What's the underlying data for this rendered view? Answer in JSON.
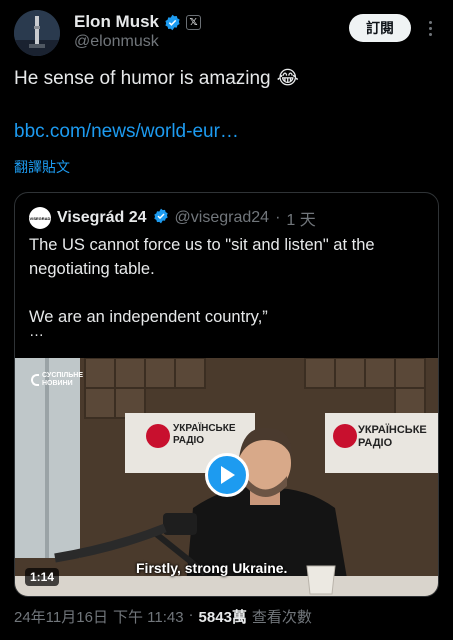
{
  "author": {
    "name": "Elon Musk",
    "handle": "@elonmusk",
    "badge_text": "𝕏"
  },
  "actions": {
    "subscribe_label": "訂閱"
  },
  "tweet": {
    "text": "He sense of humor is amazing",
    "emoji": "😂",
    "link": "bbc.com/news/world-eur…",
    "translate_label": "翻譯貼文"
  },
  "quote": {
    "avatar_text": "VISEGRAD",
    "name": "Visegrád 24",
    "handle": "@visegrad24",
    "separator": "·",
    "time": "1 天",
    "paragraphs": [
      "The US cannot force us to \"sit and listen\" at the negotiating table.",
      "We are an independent country,”"
    ],
    "ellipsis": "…",
    "video": {
      "channel_logo": [
        "СУСПІЛЬНЕ",
        "НОВИНИ"
      ],
      "sign_text": [
        "УКРАЇНСЬКЕ",
        "РАДІО"
      ],
      "duration": "1:14",
      "subtitle": "Firstly, strong Ukraine."
    }
  },
  "meta": {
    "date": "24年11月16日",
    "time": "下午 11:43",
    "separator": "·",
    "views_count": "5843萬",
    "views_label": "查看次數"
  },
  "colors": {
    "accent": "#1d9bf0",
    "text": "#e7e9ea",
    "secondary": "#71767b",
    "background": "#000000"
  }
}
